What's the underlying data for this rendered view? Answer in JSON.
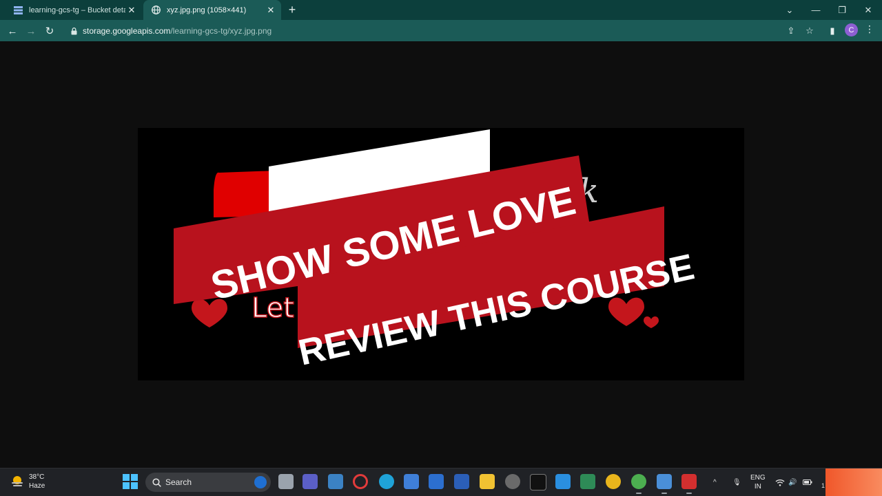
{
  "browser": {
    "tabs": [
      {
        "title": "learning-gcs-tg – Bucket details",
        "icon": "storage-bucket-icon",
        "active": false
      },
      {
        "title": "xyz.jpg.png (1058×441)",
        "icon": "globe-icon",
        "active": true
      }
    ],
    "url": {
      "host": "storage.googleapis.com",
      "path": "/learning-gcs-tg/xyz.jpg.png"
    },
    "profile_initial": "C",
    "accent_color": "#1b5b57",
    "tabstrip_color": "#0c3f3c"
  },
  "image": {
    "banner_line_1": "SHOW SOME LOVE",
    "banner_line_2": "REVIEW THIS COURSE",
    "background_text": "Let",
    "background_text_right": "k",
    "banner_color": "#c1121f"
  },
  "taskbar": {
    "weather": {
      "temp": "38°C",
      "condition": "Haze"
    },
    "search_label": "Search",
    "language": {
      "line1": "ENG",
      "line2": "IN"
    },
    "clock_fragment": "1"
  }
}
